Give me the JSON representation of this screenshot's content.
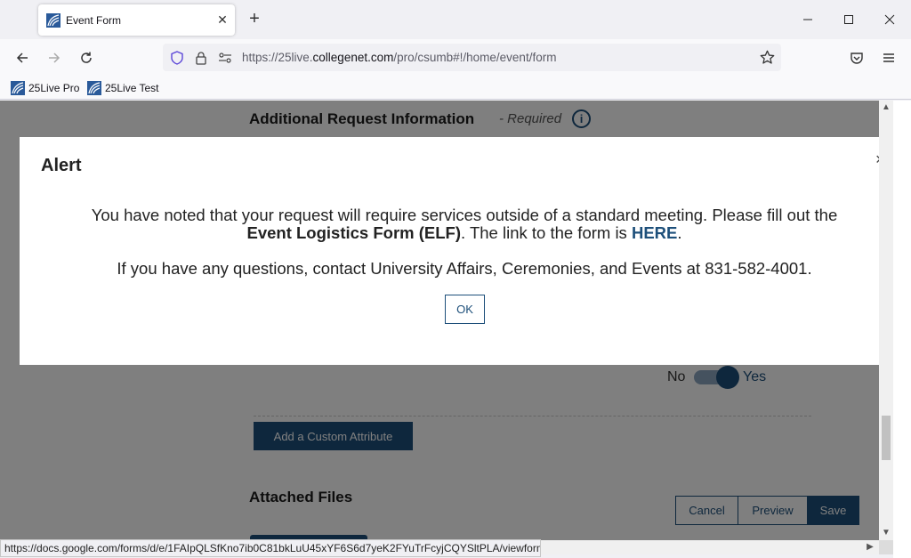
{
  "browser": {
    "tab_title": "Event Form",
    "new_tab_symbol": "+",
    "url_prefix": "https://25live.",
    "url_domain": "collegenet.com",
    "url_path": "/pro/csumb#!/home/event/form",
    "bookmarks": [
      "25Live Pro",
      "25Live Test"
    ],
    "status_url": "https://docs.google.com/forms/d/e/1FAIpQLSfKno7ib0C81bkLuU45xYF6S6d7yeK2FYuTrFcyjCQYSltPLA/viewform"
  },
  "page": {
    "section_title": "Additional Request Information",
    "section_required": "- Required",
    "toggle": {
      "off_label": "No",
      "on_label": "Yes",
      "value": "Yes"
    },
    "add_custom_attribute": "Add a Custom Attribute",
    "attached_files_title": "Attached Files",
    "actions": {
      "cancel": "Cancel",
      "preview": "Preview",
      "save": "Save"
    }
  },
  "modal": {
    "title": "Alert",
    "close_symbol": "×",
    "line1": "You have noted that your request will require services outside of a standard meeting. Please fill out the",
    "elf_label": "Event Logistics Form (ELF)",
    "line2_mid": ". The link to the form is ",
    "link_label": "HERE",
    "line2_end": ".",
    "line3": "If you have any questions, contact University Affairs, Ceremonies, and Events at 831-582-4001.",
    "ok_label": "OK"
  },
  "colors": {
    "accent": "#1d4f7a",
    "overlay": "rgba(0,0,0,0.5)"
  },
  "icons": [
    "favicon-25live",
    "close-icon",
    "back-arrow-icon",
    "forward-arrow-icon",
    "reload-icon",
    "shield-icon",
    "lock-icon",
    "permissions-icon",
    "star-icon",
    "pocket-icon",
    "menu-icon",
    "info-icon"
  ]
}
